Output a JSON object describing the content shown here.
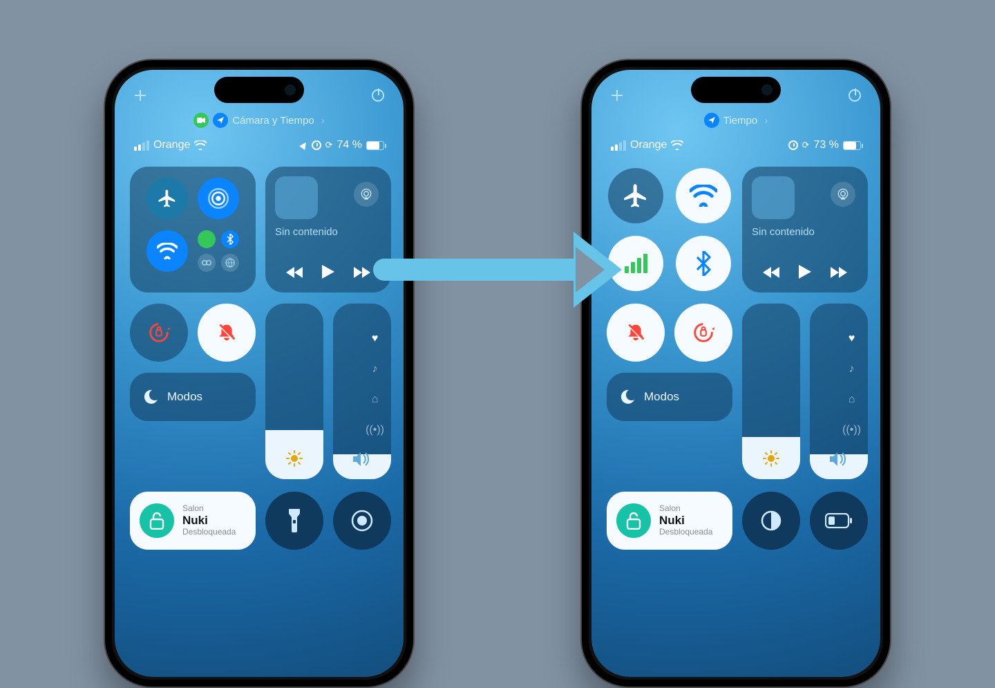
{
  "left": {
    "pill": {
      "label": "Cámara y Tiempo",
      "has_camera_pill": true,
      "has_location_pill": true
    },
    "status": {
      "carrier": "Orange",
      "battery": "74 %",
      "show_location": true
    },
    "media": {
      "label": "Sin contenido"
    },
    "focus": {
      "label": "Modos"
    },
    "home": {
      "room": "Salon",
      "device": "Nuki",
      "state": "Desbloqueada"
    },
    "brightness_pct": 28,
    "volume_pct": 14,
    "connectivity_style": "cluster",
    "bottom_buttons": [
      "flashlight",
      "screen-record"
    ]
  },
  "right": {
    "pill": {
      "label": "Tiempo",
      "has_camera_pill": false,
      "has_location_pill": true
    },
    "status": {
      "carrier": "Orange",
      "battery": "73 %",
      "show_location": false
    },
    "media": {
      "label": "Sin contenido"
    },
    "focus": {
      "label": "Modos"
    },
    "home": {
      "room": "Salon",
      "device": "Nuki",
      "state": "Desbloqueada"
    },
    "brightness_pct": 24,
    "volume_pct": 14,
    "connectivity_style": "simple",
    "bottom_buttons": [
      "contrast",
      "low-power"
    ]
  },
  "icons": {
    "airplane": "airplane-icon",
    "airdrop": "airdrop-icon",
    "wifi": "wifi-icon",
    "cellular": "cellular-icon",
    "bluetooth": "bluetooth-icon",
    "hotspot": "hotspot-icon",
    "vpn": "vpn-icon",
    "airplay": "airplay-icon",
    "rewind": "rewind-icon",
    "play": "play-icon",
    "forward": "forward-icon",
    "rotation_lock": "rotation-lock-icon",
    "silent": "silent-bell-icon",
    "moon": "moon-icon",
    "sun": "sun-icon",
    "speaker": "speaker-icon",
    "unlock": "unlock-icon",
    "flashlight": "flashlight-icon",
    "screen_record": "screen-record-icon",
    "contrast": "contrast-icon",
    "low_power": "low-power-icon",
    "heart": "heart-icon",
    "music": "music-icon",
    "house": "home-icon",
    "antenna": "antenna-icon",
    "plus": "plus-icon",
    "power": "power-icon",
    "camera": "camera-icon",
    "location": "location-arrow-icon",
    "alarm": "alarm-icon",
    "lockshield": "lock-rotation-icon"
  },
  "colors": {
    "accent_blue": "#0a84ff",
    "accent_green": "#34c759",
    "accent_red": "#ff3b30",
    "accent_teal": "#16c3a6",
    "arrow": "#67c3e8"
  }
}
